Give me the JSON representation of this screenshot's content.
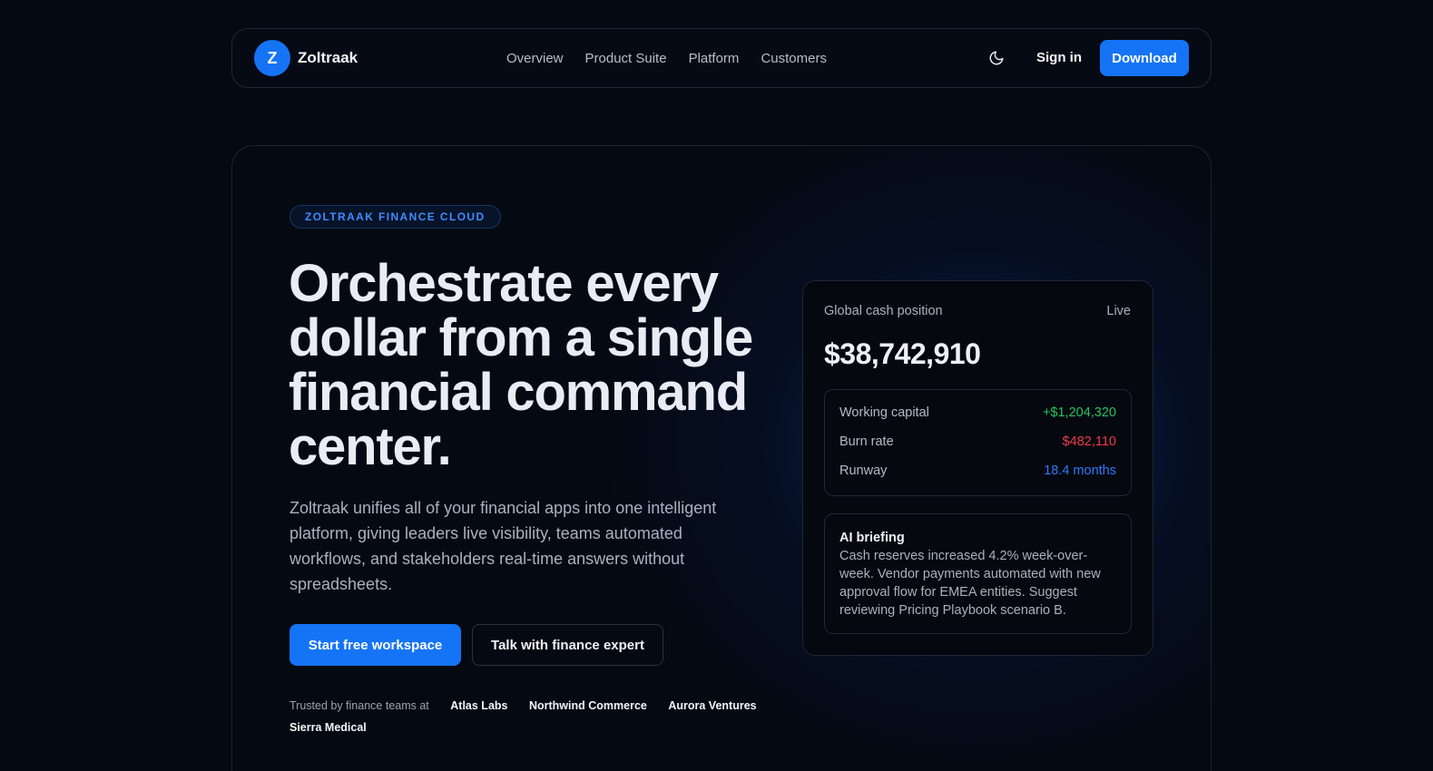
{
  "brand": {
    "logo_letter": "Z",
    "name": "Zoltraak"
  },
  "nav": {
    "links": [
      "Overview",
      "Product Suite",
      "Platform",
      "Customers"
    ],
    "theme_icon": "moon-icon",
    "signin": "Sign in",
    "download": "Download"
  },
  "hero": {
    "badge": "ZOLTRAAK FINANCE CLOUD",
    "headline": "Orchestrate every dollar from a single financial command center.",
    "subtext": "Zoltraak unifies all of your financial apps into one intelligent platform, giving leaders live visibility, teams automated workflows, and stakeholders real-time answers without spreadsheets.",
    "cta_primary": "Start free workspace",
    "cta_secondary": "Talk with finance expert",
    "trusted_label": "Trusted by finance teams at",
    "trusted_companies": [
      "Atlas Labs",
      "Northwind Commerce",
      "Aurora Ventures",
      "Sierra Medical"
    ]
  },
  "cash_card": {
    "label": "Global cash position",
    "status": "Live",
    "amount": "$38,742,910",
    "metrics": [
      {
        "name": "Working capital",
        "value": "+$1,204,320",
        "color": "#22c55e"
      },
      {
        "name": "Burn rate",
        "value": "$482,110",
        "color": "#ef3b4a"
      },
      {
        "name": "Runway",
        "value": "18.4 months",
        "color": "#2b7bff"
      }
    ],
    "ai_title": "AI briefing",
    "ai_body": "Cash reserves increased 4.2% week-over-week. Vendor payments automated with new approval flow for EMEA entities. Suggest reviewing Pricing Playbook scenario B."
  },
  "colors": {
    "accent": "#1574f6",
    "background": "#050912"
  }
}
